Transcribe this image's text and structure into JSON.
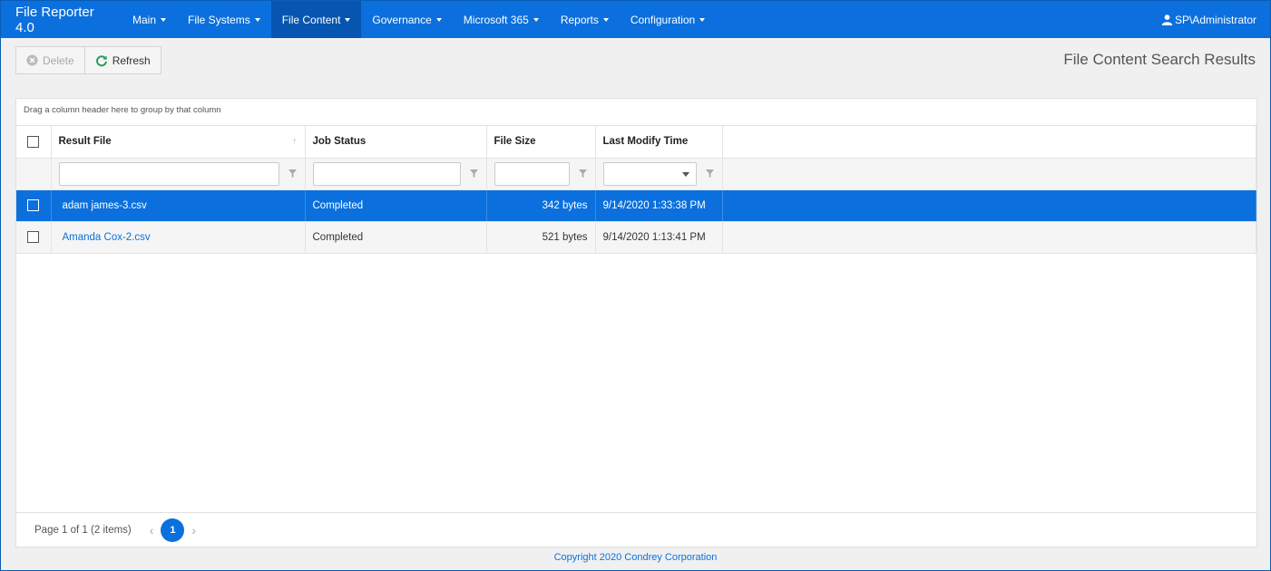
{
  "app": {
    "title": "File Reporter 4.0"
  },
  "nav": {
    "items": [
      {
        "label": "Main"
      },
      {
        "label": "File Systems"
      },
      {
        "label": "File Content"
      },
      {
        "label": "Governance"
      },
      {
        "label": "Microsoft 365"
      },
      {
        "label": "Reports"
      },
      {
        "label": "Configuration"
      }
    ],
    "active": "File Content",
    "user": "SP\\Administrator"
  },
  "toolbar": {
    "delete_label": "Delete",
    "refresh_label": "Refresh"
  },
  "page": {
    "heading": "File Content Search Results"
  },
  "grid": {
    "group_hint": "Drag a column header here to group by that column",
    "columns": [
      "Result File",
      "Job Status",
      "File Size",
      "Last Modify Time"
    ],
    "rows": [
      {
        "file": "adam james-3.csv",
        "status": "Completed",
        "size": "342 bytes",
        "modified": "9/14/2020 1:33:38 PM",
        "selected": true
      },
      {
        "file": "Amanda Cox-2.csv",
        "status": "Completed",
        "size": "521 bytes",
        "modified": "9/14/2020 1:13:41 PM",
        "selected": false
      }
    ]
  },
  "pager": {
    "summary": "Page 1 of 1 (2 items)",
    "current": "1"
  },
  "footer": {
    "copyright": "Copyright 2020 Condrey Corporation"
  },
  "colors": {
    "primary": "#0b70dd",
    "nav_active": "#0655b0"
  }
}
